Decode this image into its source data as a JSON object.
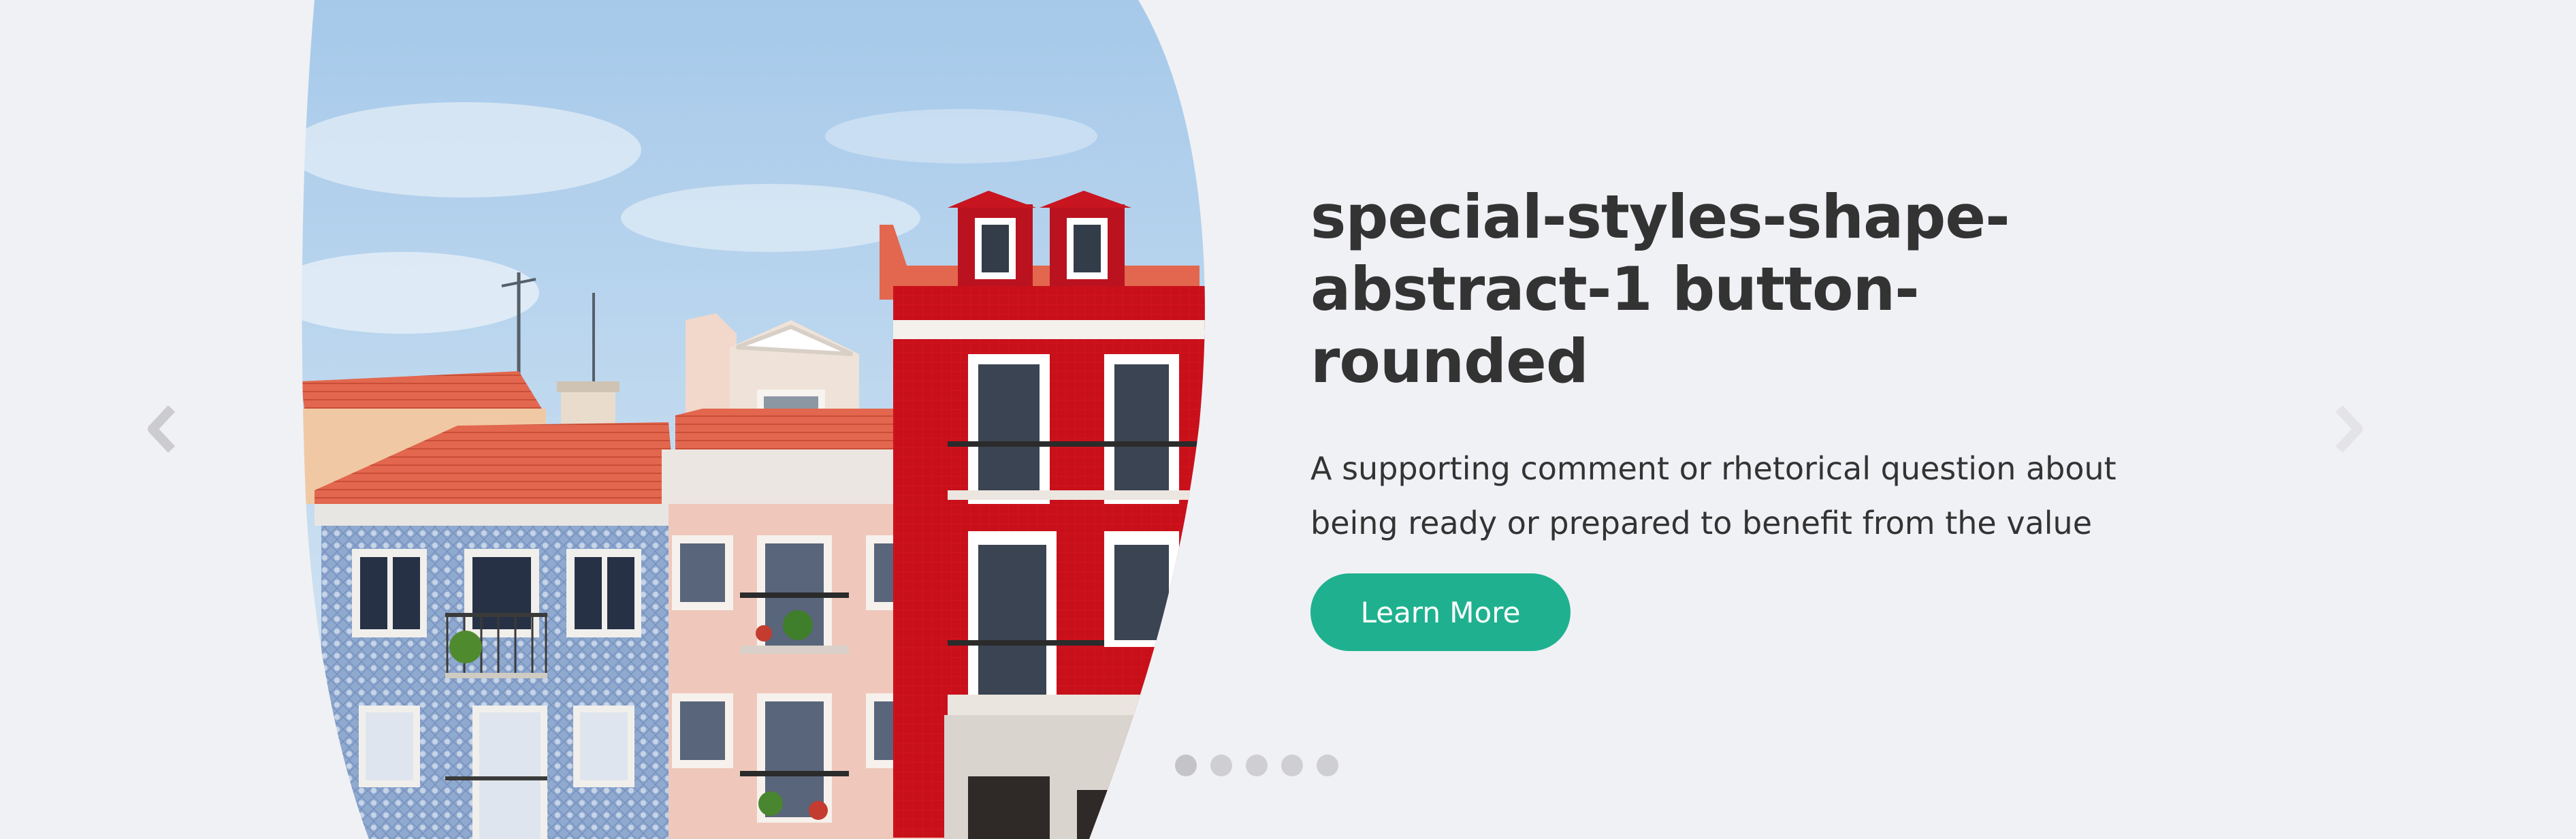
{
  "slide": {
    "title": "special-styles-shape-abstract-1 button-rounded",
    "subtitle": "A supporting comment or rhetorical question about being ready or prepared to benefit from the value",
    "button_label": "Learn More"
  },
  "navigation": {
    "prev_icon": "chevron-left-icon",
    "next_icon": "chevron-right-icon",
    "dot_count": 5,
    "active_dot": 0
  },
  "image": {
    "subject": "colorful-townhouses-photo"
  },
  "colors": {
    "background": "#f0f1f4",
    "accent": "#1fb18f",
    "text": "#333333",
    "arrow": "#cbcbd0",
    "dot": "#cfcfd3"
  }
}
